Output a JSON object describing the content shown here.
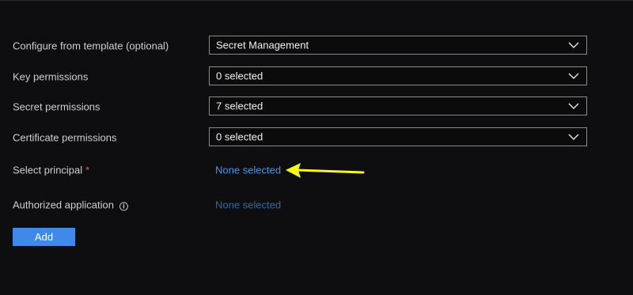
{
  "form": {
    "template": {
      "label": "Configure from template (optional)",
      "value": "Secret Management"
    },
    "key_permissions": {
      "label": "Key permissions",
      "value": "0 selected"
    },
    "secret_permissions": {
      "label": "Secret permissions",
      "value": "7 selected"
    },
    "certificate_permissions": {
      "label": "Certificate permissions",
      "value": "0 selected"
    },
    "principal": {
      "label": "Select principal",
      "required_marker": "*",
      "value": "None selected"
    },
    "authorized_application": {
      "label": "Authorized application",
      "info_glyph": "i",
      "value": "None selected"
    },
    "add_label": "Add"
  },
  "icons": {
    "dropdown": "chevron-down-icon",
    "info": "info-icon",
    "annotation": "yellow-arrow"
  },
  "colors": {
    "link": "#3f9aef",
    "link_disabled": "#2d6aa4",
    "button": "#4089e8",
    "required": "#e65c5c",
    "annotation_arrow": "#f5f51f"
  }
}
